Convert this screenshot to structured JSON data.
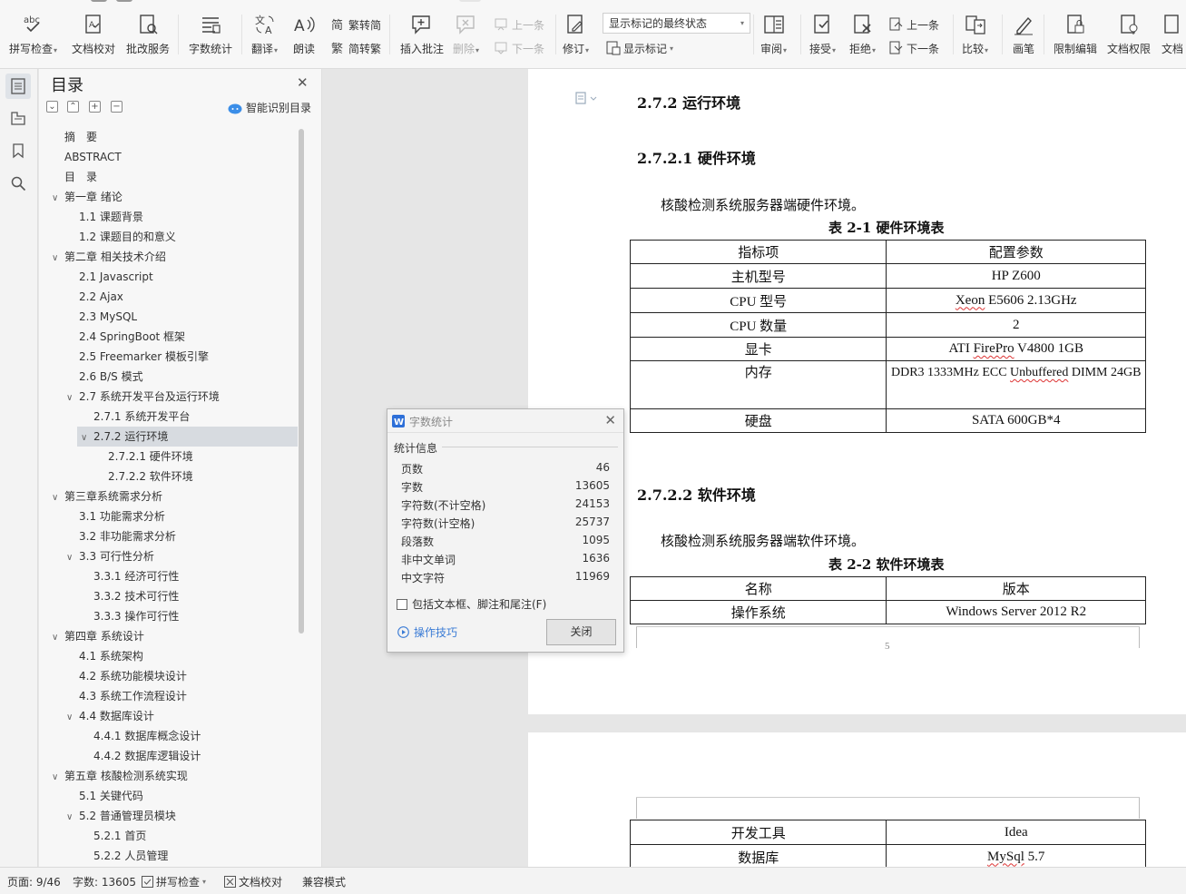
{
  "ribbon": {
    "spell_check": "拼写检查",
    "doc_proof": "文档校对",
    "batch_service": "批改服务",
    "word_count": "字数统计",
    "translate": "翻译",
    "read_aloud": "朗读",
    "trad_to_simp": "繁转简",
    "simp_to_trad": "简转繁",
    "insert_comment": "插入批注",
    "delete": "删除",
    "prev_comment": "上一条",
    "next_comment": "下一条",
    "track_changes": "修订",
    "show_markup_select": "显示标记的最终状态",
    "show_markup": "显示标记",
    "review": "审阅",
    "accept": "接受",
    "reject": "拒绝",
    "prev_change": "上一条",
    "next_change": "下一条",
    "compare": "比较",
    "pen": "画笔",
    "restrict_edit": "限制编辑",
    "doc_permission": "文档权限",
    "doc_more": "文档"
  },
  "toc": {
    "title": "目录",
    "ai_toc": "智能识别目录",
    "items": [
      {
        "label": "摘　要",
        "level": 1,
        "arrow": ""
      },
      {
        "label": "ABSTRACT",
        "level": 1,
        "arrow": ""
      },
      {
        "label": "目　录",
        "level": 1,
        "arrow": ""
      },
      {
        "label": "第一章  绪论",
        "level": 1,
        "arrow": "∨"
      },
      {
        "label": "1.1  课题背景",
        "level": 2,
        "arrow": ""
      },
      {
        "label": "1.2  课题目的和意义",
        "level": 2,
        "arrow": ""
      },
      {
        "label": "第二章  相关技术介绍",
        "level": 1,
        "arrow": "∨"
      },
      {
        "label": "2.1 Javascript",
        "level": 2,
        "arrow": ""
      },
      {
        "label": "2.2 Ajax",
        "level": 2,
        "arrow": ""
      },
      {
        "label": "2.3 MySQL",
        "level": 2,
        "arrow": ""
      },
      {
        "label": "2.4 SpringBoot 框架",
        "level": 2,
        "arrow": ""
      },
      {
        "label": "2.5 Freemarker 模板引擎",
        "level": 2,
        "arrow": ""
      },
      {
        "label": "2.6 B/S 模式",
        "level": 2,
        "arrow": ""
      },
      {
        "label": "2.7  系统开发平台及运行环境",
        "level": 2,
        "arrow": "∨"
      },
      {
        "label": "2.7.1  系统开发平台",
        "level": 3,
        "arrow": ""
      },
      {
        "label": "2.7.2  运行环境",
        "level": 3,
        "arrow": "∨",
        "selected": true
      },
      {
        "label": "2.7.2.1  硬件环境",
        "level": 4,
        "arrow": ""
      },
      {
        "label": "2.7.2.2  软件环境",
        "level": 4,
        "arrow": ""
      },
      {
        "label": "第三章系统需求分析",
        "level": 1,
        "arrow": "∨"
      },
      {
        "label": "3.1  功能需求分析",
        "level": 2,
        "arrow": ""
      },
      {
        "label": "3.2  非功能需求分析",
        "level": 2,
        "arrow": ""
      },
      {
        "label": "3.3  可行性分析",
        "level": 2,
        "arrow": "∨"
      },
      {
        "label": "3.3.1  经济可行性",
        "level": 3,
        "arrow": ""
      },
      {
        "label": "3.3.2  技术可行性",
        "level": 3,
        "arrow": ""
      },
      {
        "label": "3.3.3  操作可行性",
        "level": 3,
        "arrow": ""
      },
      {
        "label": "第四章  系统设计",
        "level": 1,
        "arrow": "∨"
      },
      {
        "label": "4.1  系统架构",
        "level": 2,
        "arrow": ""
      },
      {
        "label": "4.2  系统功能模块设计",
        "level": 2,
        "arrow": ""
      },
      {
        "label": "4.3  系统工作流程设计",
        "level": 2,
        "arrow": ""
      },
      {
        "label": "4.4  数据库设计",
        "level": 2,
        "arrow": "∨"
      },
      {
        "label": "4.4.1  数据库概念设计",
        "level": 3,
        "arrow": ""
      },
      {
        "label": "4.4.2  数据库逻辑设计",
        "level": 3,
        "arrow": ""
      },
      {
        "label": "第五章  核酸检测系统实现",
        "level": 1,
        "arrow": "∨"
      },
      {
        "label": "5.1  关键代码",
        "level": 2,
        "arrow": ""
      },
      {
        "label": "5.2  普通管理员模块",
        "level": 2,
        "arrow": "∨"
      },
      {
        "label": "5.2.1  首页",
        "level": 3,
        "arrow": ""
      },
      {
        "label": "5.2.2  人员管理",
        "level": 3,
        "arrow": ""
      }
    ]
  },
  "doc": {
    "h_272": "2.7.2  运行环境",
    "h_2721": "2.7.2.1  硬件环境",
    "p_hw": "核酸检测系统服务器端硬件环境。",
    "cap_21": "表 2-1  硬件环境表",
    "hw_header": [
      "指标项",
      "配置参数"
    ],
    "hw_rows": [
      [
        "主机型号",
        "HP Z600"
      ],
      [
        "CPU  型号",
        "Xeon E5606 2.13GHz"
      ],
      [
        "CPU  数量",
        "2"
      ],
      [
        "显卡",
        "ATI FirePro V4800 1GB"
      ],
      [
        "内存",
        "DDR3 1333MHz ECC Unbuffered DIMM 24GB"
      ],
      [
        "硬盘",
        "SATA 600GB*4"
      ]
    ],
    "h_2722": "2.7.2.2  软件环境",
    "p_sw": "核酸检测系统服务器端软件环境。",
    "cap_22": "表 2-2  软件环境表",
    "sw_header": [
      "名称",
      "版本"
    ],
    "sw_rows": [
      [
        "操作系统",
        "Windows Server 2012 R2"
      ]
    ],
    "page_number": "5",
    "sw_rows_cont": [
      [
        "开发工具",
        "Idea"
      ],
      [
        "数据库",
        "MySql 5.7"
      ]
    ]
  },
  "dialog": {
    "title": "字数统计",
    "section": "统计信息",
    "stats": [
      {
        "label": "页数",
        "value": "46"
      },
      {
        "label": "字数",
        "value": "13605"
      },
      {
        "label": "字符数(不计空格)",
        "value": "24153"
      },
      {
        "label": "字符数(计空格)",
        "value": "25737"
      },
      {
        "label": "段落数",
        "value": "1095"
      },
      {
        "label": "非中文单词",
        "value": "1636"
      },
      {
        "label": "中文字符",
        "value": "11969"
      }
    ],
    "checkbox": "包括文本框、脚注和尾注(F)",
    "tips": "操作技巧",
    "close": "关闭"
  },
  "status": {
    "page": "页面: 9/46",
    "words": "字数: 13605",
    "spell": "拼写检查",
    "proof": "文档校对",
    "compat": "兼容模式"
  }
}
